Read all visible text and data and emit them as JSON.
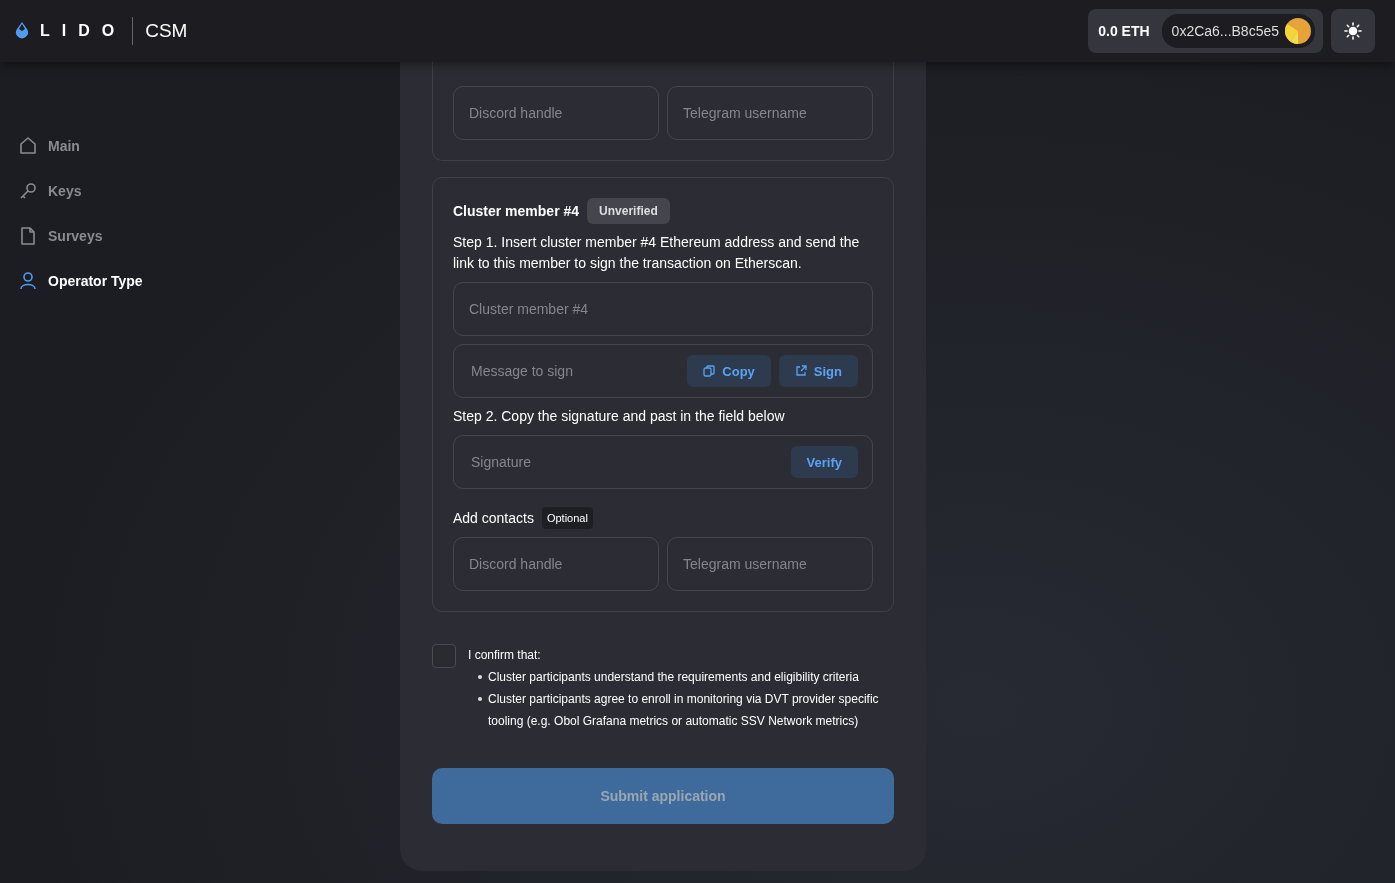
{
  "header": {
    "logo": "LIDO",
    "product": "CSM",
    "balance": "0.0 ETH",
    "address": "0x2Ca6...B8c5e5"
  },
  "sidebar": {
    "items": [
      {
        "label": "Main",
        "selected": false
      },
      {
        "label": "Keys",
        "selected": false
      },
      {
        "label": "Surveys",
        "selected": false
      },
      {
        "label": "Operator Type",
        "selected": true
      }
    ]
  },
  "top_card": {
    "contacts": [
      {
        "placeholder": "Discord handle"
      },
      {
        "placeholder": "Telegram username"
      }
    ]
  },
  "member_card": {
    "title": "Cluster member #4",
    "status": "Unverified",
    "step1": "Step 1. Insert cluster member #4 Ethereum address and send the link to this member to sign the transaction on Etherscan.",
    "address_field": {
      "placeholder": "Cluster member #4"
    },
    "message_field": {
      "placeholder": "Message to sign"
    },
    "copy_button": "Copy",
    "sign_button": "Sign",
    "step2": "Step 2. Copy the signature and past in the field below",
    "signature_field": {
      "placeholder": "Signature"
    },
    "verify_button": "Verify",
    "contacts_label": "Add contacts",
    "contacts_tag": "Optional",
    "contacts": [
      {
        "placeholder": "Discord handle"
      },
      {
        "placeholder": "Telegram username"
      }
    ]
  },
  "confirm": {
    "checked": false,
    "label": "I confirm that:",
    "points": [
      "Cluster participants understand the requirements and eligibility criteria",
      "Cluster participants agree to enroll in monitoring via DVT provider specific tooling (e.g. Obol Grafana metrics or automatic SSV Network metrics)"
    ]
  },
  "submit": {
    "label": "Submit application",
    "disabled": true
  }
}
